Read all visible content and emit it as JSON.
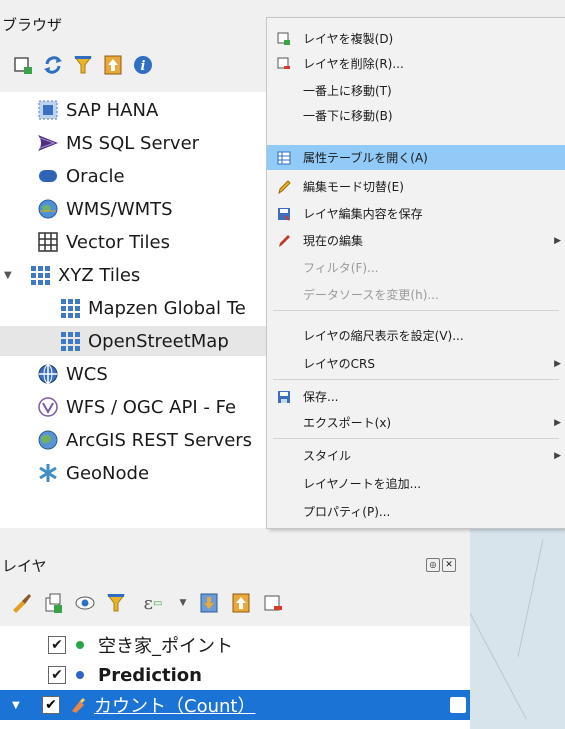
{
  "browser": {
    "title": "ブラウザ",
    "toolbar_icons": [
      "add-layer-icon",
      "refresh-icon",
      "filter-icon",
      "collapse-icon",
      "info-icon"
    ],
    "items": [
      {
        "label": "SAP HANA",
        "icon": "sap-hana-icon",
        "selected": false
      },
      {
        "label": "MS SQL Server",
        "icon": "mssql-icon",
        "selected": false
      },
      {
        "label": "Oracle",
        "icon": "oracle-icon",
        "selected": false
      },
      {
        "label": "WMS/WMTS",
        "icon": "wms-icon",
        "selected": false
      },
      {
        "label": "Vector Tiles",
        "icon": "vector-tiles-icon",
        "selected": false
      },
      {
        "label": "XYZ Tiles",
        "icon": "xyz-tiles-icon",
        "selected": false
      },
      {
        "label": "Mapzen Global Te",
        "icon": "tile-grid-icon",
        "selected": false
      },
      {
        "label": "OpenStreetMap",
        "icon": "tile-grid-icon",
        "selected": true
      },
      {
        "label": "WCS",
        "icon": "wcs-icon",
        "selected": false
      },
      {
        "label": "WFS / OGC API - Fe",
        "icon": "wfs-icon",
        "selected": false
      },
      {
        "label": "ArcGIS REST Servers",
        "icon": "arcgis-icon",
        "selected": false
      },
      {
        "label": "GeoNode",
        "icon": "geonode-icon",
        "selected": false
      }
    ]
  },
  "layers": {
    "title": "レイヤ",
    "rows": [
      {
        "label": "空き家_ポイント",
        "checked": true,
        "dot_color": "#2aa44f"
      },
      {
        "label": "Prediction",
        "checked": true,
        "dot_color": "#2f63c8"
      },
      {
        "label": "カウント（Count）",
        "checked": true,
        "selected": true
      }
    ]
  },
  "context_menu": {
    "items": [
      {
        "label": "レイヤを複製(D)",
        "icon": "duplicate-layer-icon"
      },
      {
        "label": "レイヤを削除(R)...",
        "icon": "remove-layer-icon"
      },
      {
        "label": "一番上に移動(T)",
        "icon": ""
      },
      {
        "label": "一番下に移動(B)",
        "icon": ""
      },
      {
        "label": "属性テーブルを開く(A)",
        "icon": "attribute-table-icon",
        "highlight": true
      },
      {
        "label": "編集モード切替(E)",
        "icon": "pencil-icon"
      },
      {
        "label": "レイヤ編集内容を保存",
        "icon": "save-edits-icon"
      },
      {
        "label": "現在の編集",
        "icon": "current-edits-icon",
        "submenu": true
      },
      {
        "label": "フィルタ(F)...",
        "icon": "",
        "disabled": true
      },
      {
        "label": "データソースを変更(h)...",
        "icon": "",
        "disabled": true
      },
      {
        "label": "レイヤの縮尺表示を設定(V)...",
        "icon": ""
      },
      {
        "label": "レイヤのCRS",
        "icon": "",
        "submenu": true
      },
      {
        "label": "保存...",
        "icon": "save-icon"
      },
      {
        "label": "エクスポート(x)",
        "icon": "",
        "submenu": true
      },
      {
        "label": "スタイル",
        "icon": "",
        "submenu": true
      },
      {
        "label": "レイヤノートを追加...",
        "icon": ""
      },
      {
        "label": "プロパティ(P)...",
        "icon": ""
      }
    ]
  },
  "colors": {
    "highlight": "#91c9f7",
    "selection": "#1c73d6"
  }
}
